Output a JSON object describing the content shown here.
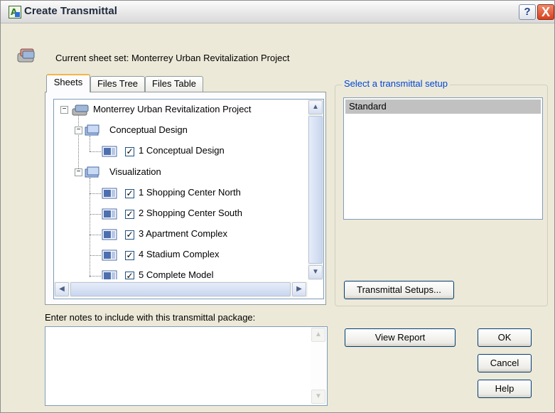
{
  "window": {
    "title": "Create Transmittal",
    "help_label": "?",
    "close_label": "X"
  },
  "current_sheet_set": "Current sheet set: Monterrey Urban Revitalization Project",
  "tabs": [
    {
      "label": "Sheets",
      "active": true
    },
    {
      "label": "Files Tree",
      "active": false
    },
    {
      "label": "Files Table",
      "active": false
    }
  ],
  "tree": {
    "root": {
      "label": "Monterrey Urban Revitalization Project",
      "expanded": true
    },
    "groups": [
      {
        "label": "Conceptual Design",
        "expanded": true,
        "sheets": [
          {
            "label": "1 Conceptual Design",
            "checked": true
          }
        ]
      },
      {
        "label": "Visualization",
        "expanded": true,
        "sheets": [
          {
            "label": "1 Shopping Center North",
            "checked": true
          },
          {
            "label": "2 Shopping Center South",
            "checked": true
          },
          {
            "label": "3 Apartment Complex",
            "checked": true
          },
          {
            "label": "4 Stadium Complex",
            "checked": true
          },
          {
            "label": "5 Complete Model",
            "checked": true
          }
        ]
      }
    ]
  },
  "setup": {
    "group_label": "Select a transmittal setup",
    "items": [
      "Standard"
    ],
    "selected": "Standard",
    "setups_button": "Transmittal Setups..."
  },
  "notes": {
    "label": "Enter notes to include with this transmittal package:",
    "value": ""
  },
  "buttons": {
    "view_report": "View Report",
    "ok": "OK",
    "cancel": "Cancel",
    "help": "Help"
  },
  "icons": {
    "expanded": "minus-box",
    "checked": "check-mark",
    "scroll_up": "up-arrow",
    "scroll_down": "down-arrow",
    "scroll_left": "left-arrow",
    "scroll_right": "right-arrow"
  },
  "colors": {
    "dialog_bg": "#ece9d8",
    "group_title": "#0046d5",
    "selection": "#c1c1c1",
    "active_tab_accent": "#f5b544"
  }
}
